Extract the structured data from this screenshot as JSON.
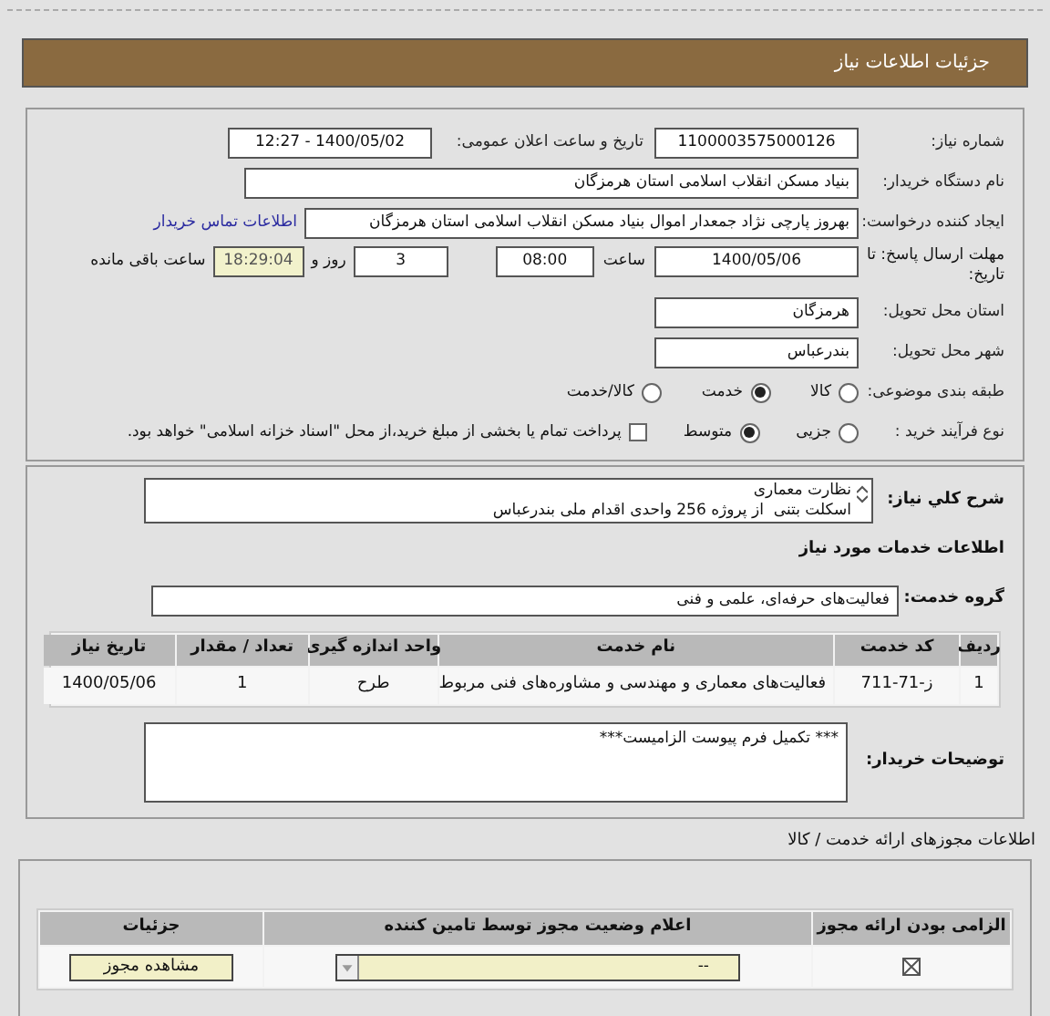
{
  "header": {
    "title": "جزئیات اطلاعات نیاز"
  },
  "need_number": {
    "label": "شماره نیاز:",
    "value": "1100003575000126"
  },
  "announce": {
    "label": "تاریخ و ساعت اعلان عمومی:",
    "value": "1400/05/02 - 12:27"
  },
  "buyer": {
    "label": "نام دستگاه خریدار:",
    "value": "بنیاد مسکن انقلاب اسلامی استان هرمزگان"
  },
  "creator": {
    "label": "ایجاد کننده درخواست:",
    "value": "بهروز  پارچی نژاد جمعدار اموال بنیاد مسکن انقلاب اسلامی استان هرمزگان",
    "link": "اطلاعات تماس خریدار"
  },
  "deadline": {
    "label": "مهلت ارسال پاسخ: تا تاریخ:",
    "date": "1400/05/06",
    "time_label": "ساعت",
    "time": "08:00",
    "days": "3",
    "days_label": "روز و",
    "remaining": "18:29:04",
    "remaining_label": "ساعت باقی مانده"
  },
  "province": {
    "label": "استان محل تحویل:",
    "value": "هرمزگان"
  },
  "city": {
    "label": "شهر محل تحویل:",
    "value": "بندرعباس"
  },
  "category": {
    "label": "طبقه بندی موضوعی:",
    "options": [
      {
        "label": "کالا",
        "selected": false
      },
      {
        "label": "خدمت",
        "selected": true
      },
      {
        "label": "کالا/خدمت",
        "selected": false
      }
    ]
  },
  "purchase": {
    "label": "نوع فرآیند خرید :",
    "options": [
      {
        "label": "جزیی",
        "selected": false
      },
      {
        "label": "متوسط",
        "selected": true
      }
    ],
    "payment": {
      "checked": false,
      "text": "پرداخت تمام یا بخشی از مبلغ خرید،از محل \"اسناد خزانه اسلامی\" خواهد بود."
    }
  },
  "description": {
    "label": "شرح کلي نياز:",
    "lines": [
      "نظارت معماری",
      "اسکلت بتنی  از پروژه 256 واحدی اقدام ملی بندرعباس"
    ]
  },
  "services_title": "اطلاعات خدمات مورد نیاز",
  "service_group": {
    "label": "گروه خدمت:",
    "value": "فعالیت‌های حرفه‌ای، علمی و فنی"
  },
  "services_table": {
    "columns": [
      "ردیف",
      "کد خدمت",
      "نام خدمت",
      "واحد اندازه گیری",
      "تعداد / مقدار",
      "تاریخ نیاز"
    ],
    "rows": [
      [
        "1",
        "ز-71-711",
        "فعالیت‌های معماری و مهندسی و مشاوره‌های فنی مربوط",
        "طرح",
        "1",
        "1400/05/06"
      ]
    ]
  },
  "buyer_notes": {
    "label": "توضیحات خریدار:",
    "text": "*** تکمیل فرم پیوست الزامیست***"
  },
  "permits_title": "اطلاعات مجوزهای ارائه خدمت / کالا",
  "permits_table": {
    "columns": [
      "الزامی بودن ارائه مجوز",
      "اعلام وضعیت مجوز توسط تامین کننده",
      "جزئیات"
    ],
    "rows": [
      {
        "required": true,
        "status": "--",
        "button": "مشاهده مجوز"
      }
    ]
  }
}
